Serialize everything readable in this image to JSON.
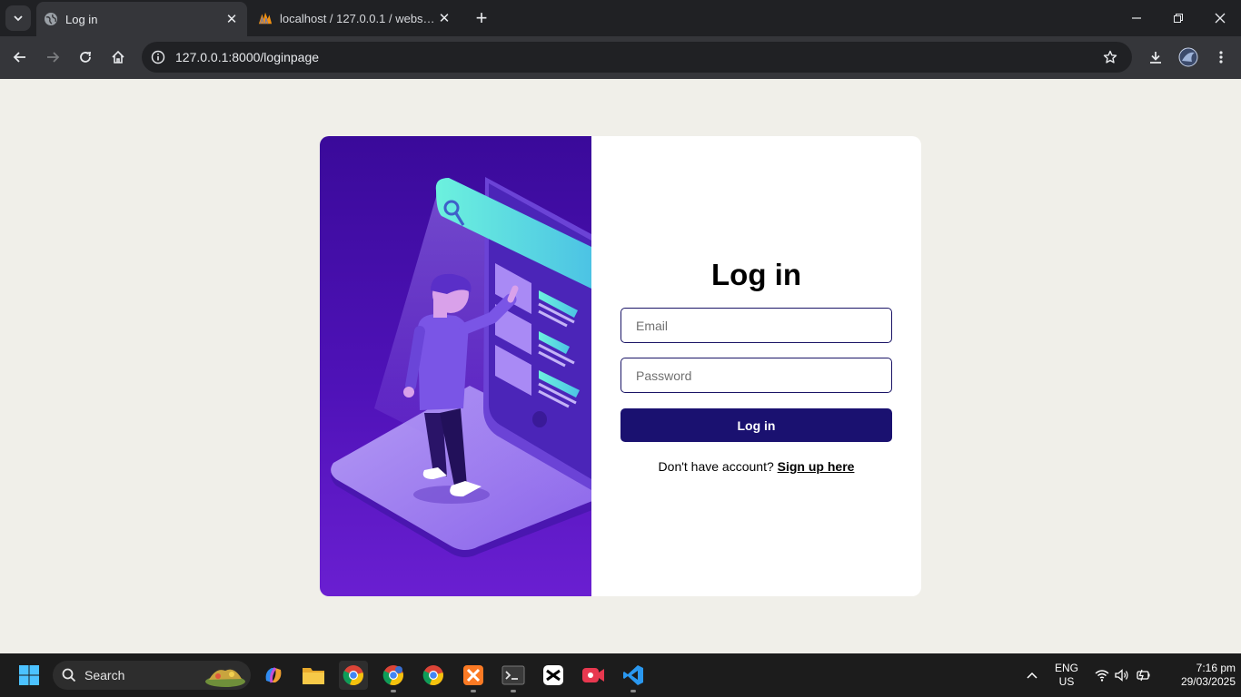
{
  "browser": {
    "tabs": [
      {
        "title": "Log in",
        "active": true
      },
      {
        "title": "localhost / 127.0.0.1 / websys_m",
        "active": false
      }
    ],
    "url": "127.0.0.1:8000/loginpage"
  },
  "login": {
    "title": "Log in",
    "email_placeholder": "Email",
    "password_placeholder": "Password",
    "submit_label": "Log in",
    "signup_prompt": "Don't have account?",
    "signup_link": "Sign up here"
  },
  "taskbar": {
    "search_label": "Search",
    "language": "ENG",
    "region": "US",
    "time": "7:16 pm",
    "date": "29/03/2025"
  },
  "colors": {
    "page_background": "#f0efe9",
    "button": "#1a1170",
    "input_border": "#1a1466",
    "illustration_purple": "#4f12b8",
    "illustration_cyan": "#5ee6d8"
  }
}
